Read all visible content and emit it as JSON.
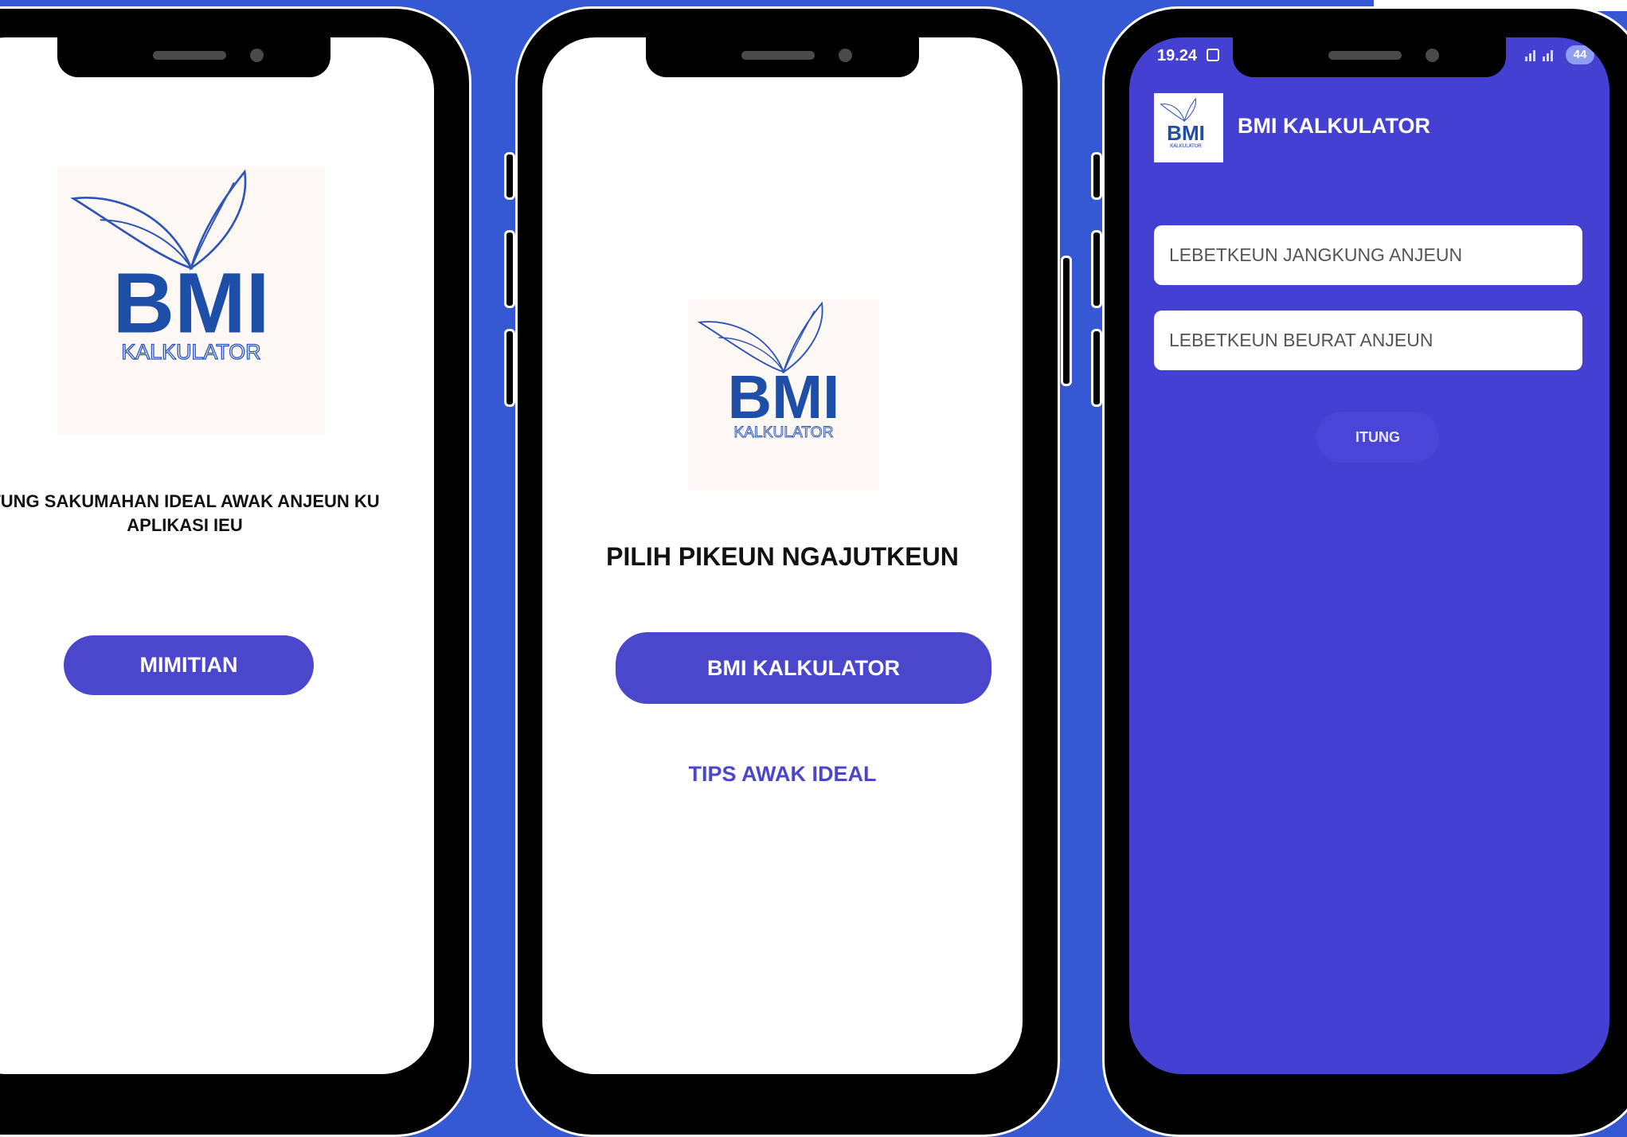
{
  "colors": {
    "background": "#3558d3",
    "primary_button": "#4b47cc",
    "calculator_screen": "#4440d2",
    "logo_blue": "#1e4fa8"
  },
  "logo": {
    "title": "BMI",
    "subtitle": "KALKULATOR"
  },
  "screen1": {
    "message_line1": "TUNG SAKUMAHAN IDEAL AWAK ANJEUN KU",
    "message_line2": "APLIKASI IEU",
    "start_button": "MIMITIAN"
  },
  "screen2": {
    "heading": "PILIH PIKEUN NGAJUTKEUN",
    "bmi_button": "BMI KALKULATOR",
    "tips_link": "TIPS AWAK IDEAL"
  },
  "screen3": {
    "status": {
      "time": "19.24",
      "battery": "44"
    },
    "app_title": "BMI KALKULATOR",
    "height_placeholder": "LEBETKEUN JANGKUNG ANJEUN",
    "weight_placeholder": "LEBETKEUN BEURAT ANJEUN",
    "calculate_button": "ITUNG"
  }
}
